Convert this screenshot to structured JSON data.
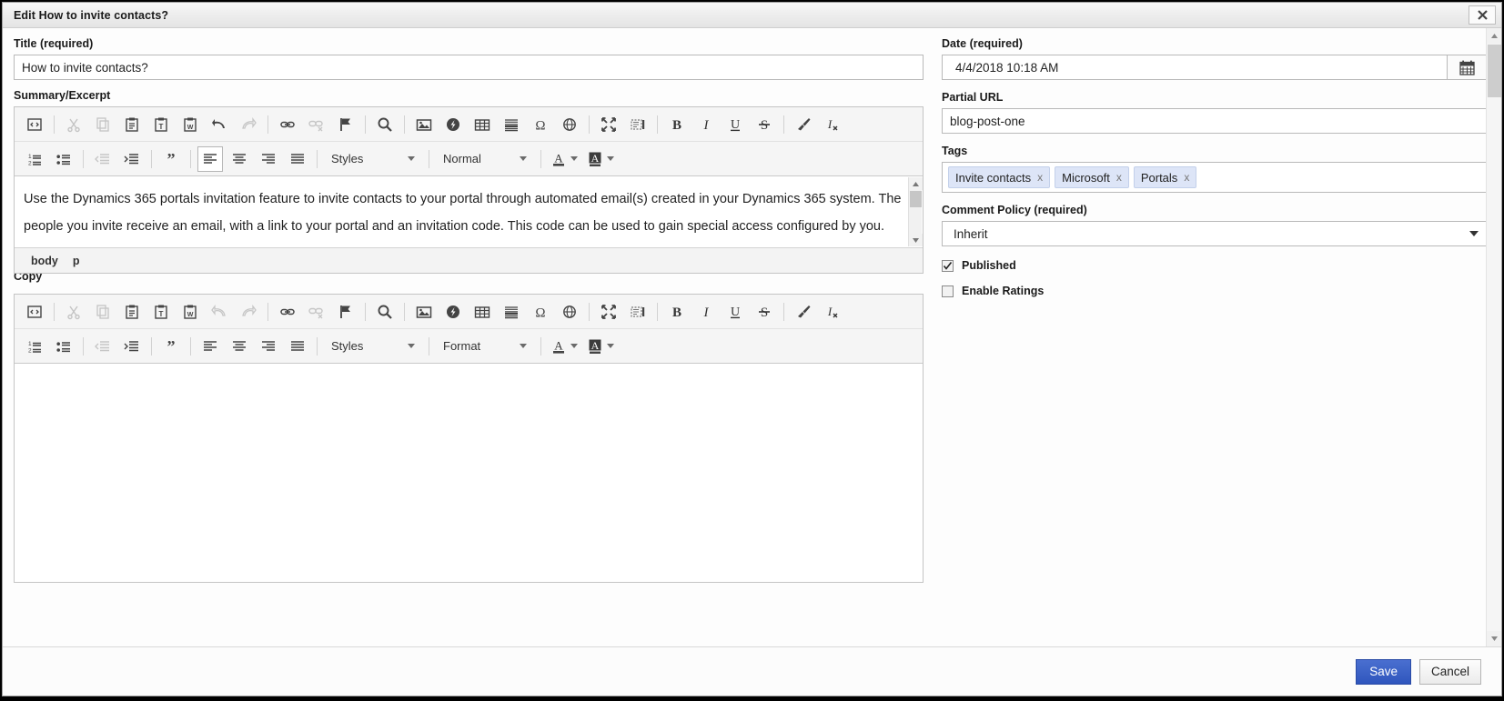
{
  "window": {
    "title": "Edit How to invite contacts?",
    "close_icon": "close-icon"
  },
  "left": {
    "title_label": "Title (required)",
    "title_value": "How to invite contacts?",
    "title_placeholder": "",
    "summary_label": "Summary/Excerpt",
    "summary_text": "Use the Dynamics 365 portals invitation feature to invite contacts to your portal through automated email(s) created in your Dynamics 365 system. The people you invite receive an email, with a link to your portal and an invitation code. This code can be used to gain special access configured by you. With this feature you have the ability to:",
    "summary_statusbar": [
      "body",
      "p"
    ],
    "copy_label": "Copy",
    "copy_text": ""
  },
  "toolbar": {
    "row1": [
      {
        "name": "source-icon",
        "title": "Source"
      },
      {
        "name": "separator"
      },
      {
        "name": "cut-icon",
        "title": "Cut",
        "disabled": true
      },
      {
        "name": "copy-icon",
        "title": "Copy",
        "disabled": true
      },
      {
        "name": "paste-icon",
        "title": "Paste"
      },
      {
        "name": "paste-as-plain-text-icon",
        "title": "Paste as plain text"
      },
      {
        "name": "paste-from-word-icon",
        "title": "Paste from Word"
      },
      {
        "name": "undo-icon",
        "title": "Undo"
      },
      {
        "name": "redo-icon",
        "title": "Redo",
        "disabled": true
      },
      {
        "name": "separator"
      },
      {
        "name": "link-icon",
        "title": "Link"
      },
      {
        "name": "unlink-icon",
        "title": "Unlink",
        "disabled": true
      },
      {
        "name": "anchor-flag-icon",
        "title": "Anchor"
      },
      {
        "name": "separator"
      },
      {
        "name": "search-icon",
        "title": "Find"
      },
      {
        "name": "separator"
      },
      {
        "name": "image-icon",
        "title": "Image"
      },
      {
        "name": "flash-icon",
        "title": "Flash"
      },
      {
        "name": "table-icon",
        "title": "Table"
      },
      {
        "name": "horizontal-rule-icon",
        "title": "Horizontal Line"
      },
      {
        "name": "special-character-icon",
        "title": "Special Character"
      },
      {
        "name": "iframe-globe-icon",
        "title": "IFrame"
      },
      {
        "name": "separator"
      },
      {
        "name": "maximize-icon",
        "title": "Maximize"
      },
      {
        "name": "show-blocks-icon",
        "title": "Show Blocks"
      },
      {
        "name": "separator"
      },
      {
        "name": "bold-icon",
        "title": "Bold"
      },
      {
        "name": "italic-icon",
        "title": "Italic"
      },
      {
        "name": "underline-icon",
        "title": "Underline"
      },
      {
        "name": "strikethrough-icon",
        "title": "Strike Through"
      },
      {
        "name": "separator"
      },
      {
        "name": "remove-format-brush-icon",
        "title": "Remove Format"
      },
      {
        "name": "clear-text-format-icon",
        "title": "Clear Formatting"
      }
    ],
    "row2": [
      {
        "name": "numbered-list-icon",
        "title": "Insert/Remove Numbered List"
      },
      {
        "name": "bulleted-list-icon",
        "title": "Insert/Remove Bulleted List"
      },
      {
        "name": "separator"
      },
      {
        "name": "decrease-indent-icon",
        "title": "Decrease Indent",
        "disabled": true
      },
      {
        "name": "increase-indent-icon",
        "title": "Increase Indent"
      },
      {
        "name": "separator"
      },
      {
        "name": "blockquote-icon",
        "title": "Block Quote"
      },
      {
        "name": "separator"
      },
      {
        "name": "align-left-icon",
        "title": "Align Left",
        "active": true
      },
      {
        "name": "align-center-icon",
        "title": "Center"
      },
      {
        "name": "align-right-icon",
        "title": "Align Right"
      },
      {
        "name": "justify-icon",
        "title": "Justify"
      }
    ],
    "styles_label": "Styles",
    "format_label_summary": "Normal",
    "format_label_copy": "Format",
    "text-color-icon": "text-color-icon",
    "bg-color-icon": "background-color-icon"
  },
  "right": {
    "date_label": "Date (required)",
    "date_value": "4/4/2018 10:18 AM",
    "date_icon": "calendar-icon",
    "url_label": "Partial URL",
    "url_value": "blog-post-one",
    "tags_label": "Tags",
    "tags": [
      "Invite contacts",
      "Microsoft",
      "Portals"
    ],
    "tag_remove_label": "x",
    "comment_policy_label": "Comment Policy (required)",
    "comment_policy_value": "Inherit",
    "published_label": "Published",
    "published_checked": true,
    "enable_ratings_label": "Enable Ratings",
    "enable_ratings_checked": false
  },
  "footer": {
    "save_label": "Save",
    "cancel_label": "Cancel"
  },
  "colors": {
    "accent": "#2f56bd",
    "tag_bg": "#dde5f7",
    "title_bar": "#ededed"
  }
}
